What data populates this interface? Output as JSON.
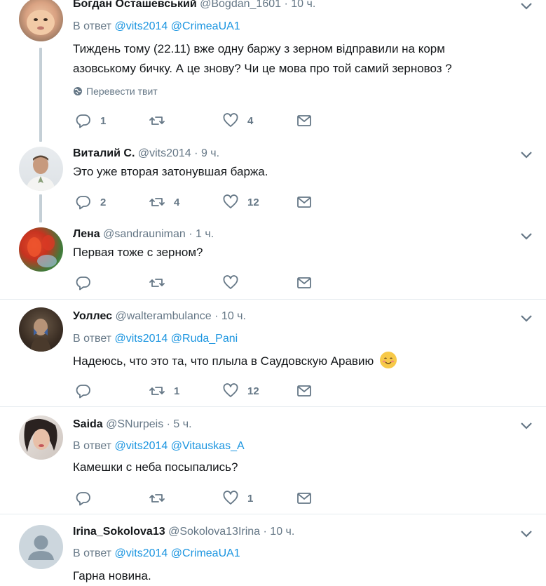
{
  "tweets": [
    {
      "name": "Богдан Осташевський",
      "handle": "@Bogdan_1601",
      "dot": "·",
      "time": "10 ч.",
      "reply_prefix": "В ответ",
      "mentions": [
        "@vits2014",
        "@CrimeaUA1"
      ],
      "text_lines": [
        "Тиждень тому (22.11) вже одну баржу з зерном відправили на корм",
        "азовському бичку. А це знову? Чи це мова про той самий зерновоз ?"
      ],
      "translate": "Перевести твит",
      "reply_count": "1",
      "retweet_count": "",
      "like_count": "4"
    },
    {
      "name": "Виталий С.",
      "handle": "@vits2014",
      "dot": "·",
      "time": "9 ч.",
      "text": "Это уже вторая затонувшая баржа.",
      "reply_count": "2",
      "retweet_count": "4",
      "like_count": "12"
    },
    {
      "name": "Лена",
      "handle": "@sandrauniman",
      "dot": "·",
      "time": "1 ч.",
      "text": "Первая тоже с зерном?",
      "reply_count": "",
      "retweet_count": "",
      "like_count": ""
    },
    {
      "name": "Уоллес",
      "handle": "@walterambulance",
      "dot": "·",
      "time": "10 ч.",
      "reply_prefix": "В ответ",
      "mentions": [
        "@vits2014",
        "@Ruda_Pani"
      ],
      "text": "Надеюсь, что это та, что плыла в Саудовскую Аравию",
      "emoji": "smiling-face-emoji",
      "reply_count": "",
      "retweet_count": "1",
      "like_count": "12"
    },
    {
      "name": "Saida",
      "handle": "@SNurpeis",
      "dot": "·",
      "time": "5 ч.",
      "reply_prefix": "В ответ",
      "mentions": [
        "@vits2014",
        "@Vitauskas_A"
      ],
      "text": "Камешки с неба посыпались?",
      "reply_count": "",
      "retweet_count": "",
      "like_count": "1"
    },
    {
      "name": "Irina_Sokolova13",
      "handle": "@Sokolova13Irina",
      "dot": "·",
      "time": "10 ч.",
      "reply_prefix": "В ответ",
      "mentions": [
        "@vits2014",
        "@CrimeaUA1"
      ],
      "text": "Гарна новина."
    }
  ],
  "icons": {
    "reply": "reply-icon",
    "retweet": "retweet-icon",
    "like": "heart-icon",
    "dm": "envelope-icon",
    "more": "chevron-down-icon",
    "translate": "globe-icon"
  },
  "colors": {
    "link": "#1b95e0",
    "muted": "#657786",
    "thread_line": "#c4cfd6",
    "separator": "#e6ecf0"
  }
}
